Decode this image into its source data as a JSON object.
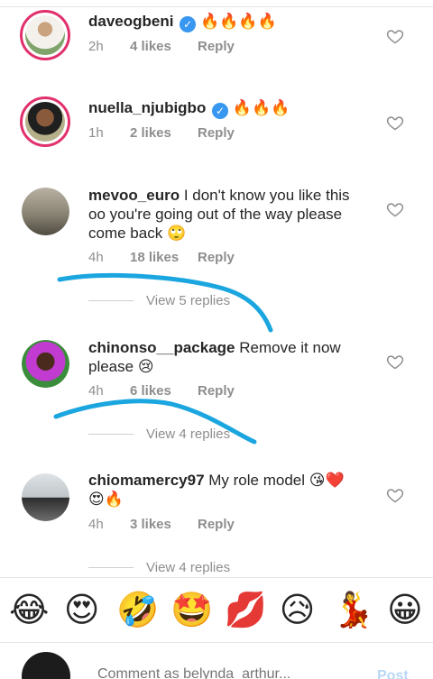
{
  "comments": [
    {
      "username": "daveogbeni",
      "verified": true,
      "text": "",
      "emoji": "🔥🔥🔥🔥",
      "time": "2h",
      "likes": "4 likes",
      "reply": "Reply"
    },
    {
      "username": "nuella_njubigbo",
      "verified": true,
      "text": "",
      "emoji": "🔥🔥🔥",
      "time": "1h",
      "likes": "2 likes",
      "reply": "Reply"
    },
    {
      "username": "mevoo_euro",
      "verified": false,
      "text": "I don't know you like this oo you're going out of the way please come back",
      "emoji": "🙄",
      "time": "4h",
      "likes": "18 likes",
      "reply": "Reply",
      "view_replies": "View 5 replies"
    },
    {
      "username": "chinonso__package",
      "verified": false,
      "text": "Remove it now please",
      "emoji": "😢",
      "time": "4h",
      "likes": "6 likes",
      "reply": "Reply",
      "view_replies": "View 4 replies"
    },
    {
      "username": "chiomamercy97",
      "verified": false,
      "text": "My role model",
      "emoji": "😘❤️😍🔥",
      "time": "4h",
      "likes": "3 likes",
      "reply": "Reply",
      "view_replies": "View 4 replies"
    }
  ],
  "emoji_bar": [
    "😂",
    "😍",
    "🤣",
    "🤩",
    "💋",
    "😥",
    "💃",
    "😀"
  ],
  "composer": {
    "placeholder": "Comment as belynda_arthur...",
    "post_label": "Post"
  },
  "colors": {
    "story_ring": "#e1306c",
    "verified": "#3897f0",
    "scribble": "#1ba6e0"
  }
}
